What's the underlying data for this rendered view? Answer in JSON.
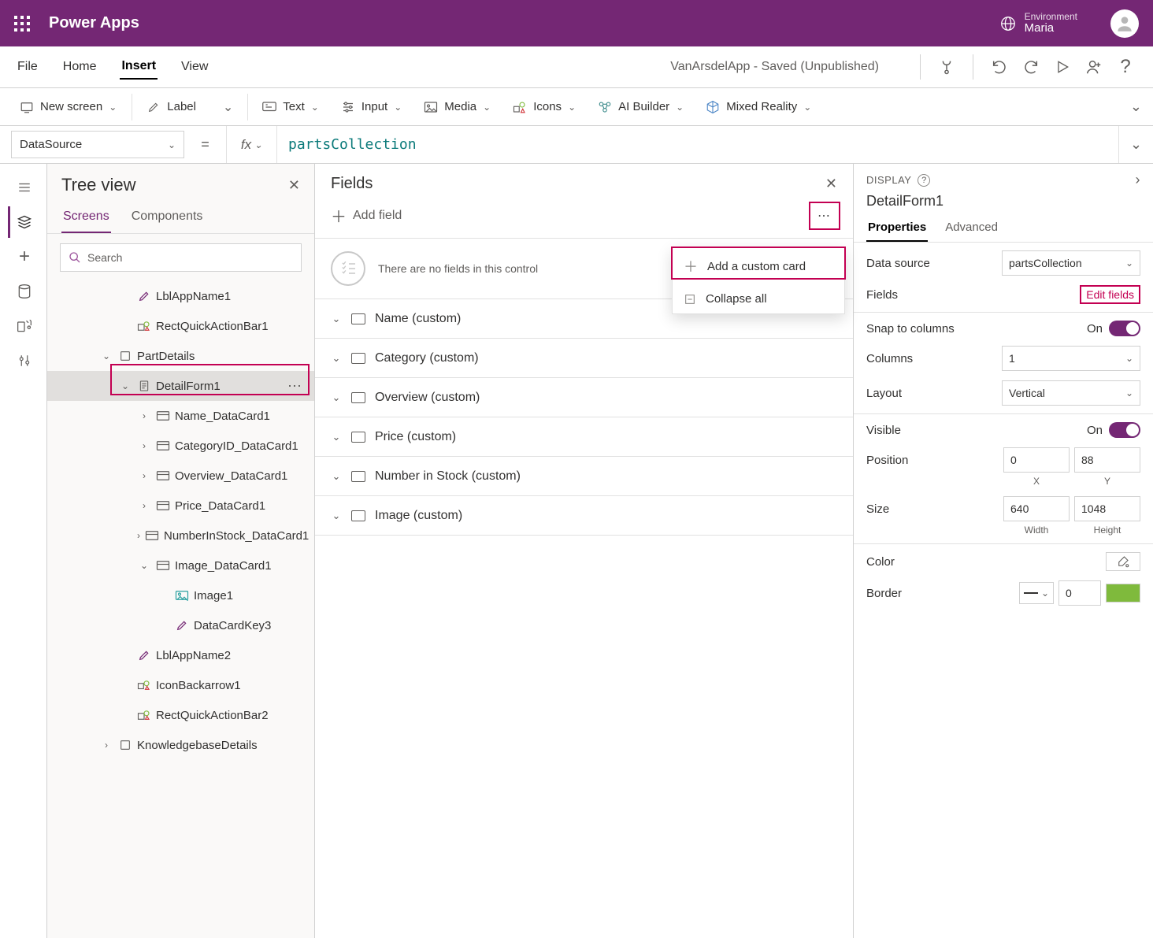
{
  "titlebar": {
    "app_name": "Power Apps",
    "env_label": "Environment",
    "env_name": "Maria"
  },
  "menubar": {
    "items": [
      "File",
      "Home",
      "Insert",
      "View"
    ],
    "active_index": 2,
    "doc_status": "VanArsdelApp - Saved (Unpublished)"
  },
  "ribbon": {
    "new_screen": "New screen",
    "label": "Label",
    "text": "Text",
    "input": "Input",
    "media": "Media",
    "icons": "Icons",
    "ai_builder": "AI Builder",
    "mixed_reality": "Mixed Reality"
  },
  "formulabar": {
    "property": "DataSource",
    "formula": "partsCollection"
  },
  "tree": {
    "title": "Tree view",
    "tabs": {
      "screens": "Screens",
      "components": "Components"
    },
    "search_placeholder": "Search",
    "items": [
      {
        "label": "LblAppName1",
        "icon": "label",
        "depth": 1
      },
      {
        "label": "RectQuickActionBar1",
        "icon": "shape",
        "depth": 1
      },
      {
        "label": "PartDetails",
        "icon": "screen",
        "depth": 0,
        "expanded": true
      },
      {
        "label": "DetailForm1",
        "icon": "form",
        "depth": 1,
        "expanded": true,
        "selected": true
      },
      {
        "label": "Name_DataCard1",
        "icon": "card",
        "depth": 2,
        "expandable": true
      },
      {
        "label": "CategoryID_DataCard1",
        "icon": "card",
        "depth": 2,
        "expandable": true
      },
      {
        "label": "Overview_DataCard1",
        "icon": "card",
        "depth": 2,
        "expandable": true
      },
      {
        "label": "Price_DataCard1",
        "icon": "card",
        "depth": 2,
        "expandable": true
      },
      {
        "label": "NumberInStock_DataCard1",
        "icon": "card",
        "depth": 2,
        "expandable": true
      },
      {
        "label": "Image_DataCard1",
        "icon": "card",
        "depth": 2,
        "expanded": true
      },
      {
        "label": "Image1",
        "icon": "image",
        "depth": 3
      },
      {
        "label": "DataCardKey3",
        "icon": "label",
        "depth": 3
      },
      {
        "label": "LblAppName2",
        "icon": "label",
        "depth": 1
      },
      {
        "label": "IconBackarrow1",
        "icon": "iconctl",
        "depth": 1
      },
      {
        "label": "RectQuickActionBar2",
        "icon": "shape",
        "depth": 1
      },
      {
        "label": "KnowledgebaseDetails",
        "icon": "screen",
        "depth": 0,
        "expandable": true
      }
    ]
  },
  "fields_panel": {
    "title": "Fields",
    "add_field": "Add field",
    "empty_msg": "There are no fields in this control",
    "fields": [
      "Name (custom)",
      "Category (custom)",
      "Overview (custom)",
      "Price (custom)",
      "Number in Stock (custom)",
      "Image (custom)"
    ],
    "context": {
      "add_custom": "Add a custom card",
      "collapse": "Collapse all"
    }
  },
  "props": {
    "header": "DISPLAY",
    "object": "DetailForm1",
    "tabs": {
      "properties": "Properties",
      "advanced": "Advanced"
    },
    "data_source": {
      "label": "Data source",
      "value": "partsCollection"
    },
    "fields": {
      "label": "Fields",
      "link": "Edit fields"
    },
    "snap": {
      "label": "Snap to columns",
      "value": "On"
    },
    "columns": {
      "label": "Columns",
      "value": "1"
    },
    "layout": {
      "label": "Layout",
      "value": "Vertical"
    },
    "visible": {
      "label": "Visible",
      "value": "On"
    },
    "position": {
      "label": "Position",
      "x": "0",
      "y": "88",
      "xl": "X",
      "yl": "Y"
    },
    "size": {
      "label": "Size",
      "w": "640",
      "h": "1048",
      "wl": "Width",
      "hl": "Height"
    },
    "color": {
      "label": "Color"
    },
    "border": {
      "label": "Border",
      "width": "0"
    }
  }
}
